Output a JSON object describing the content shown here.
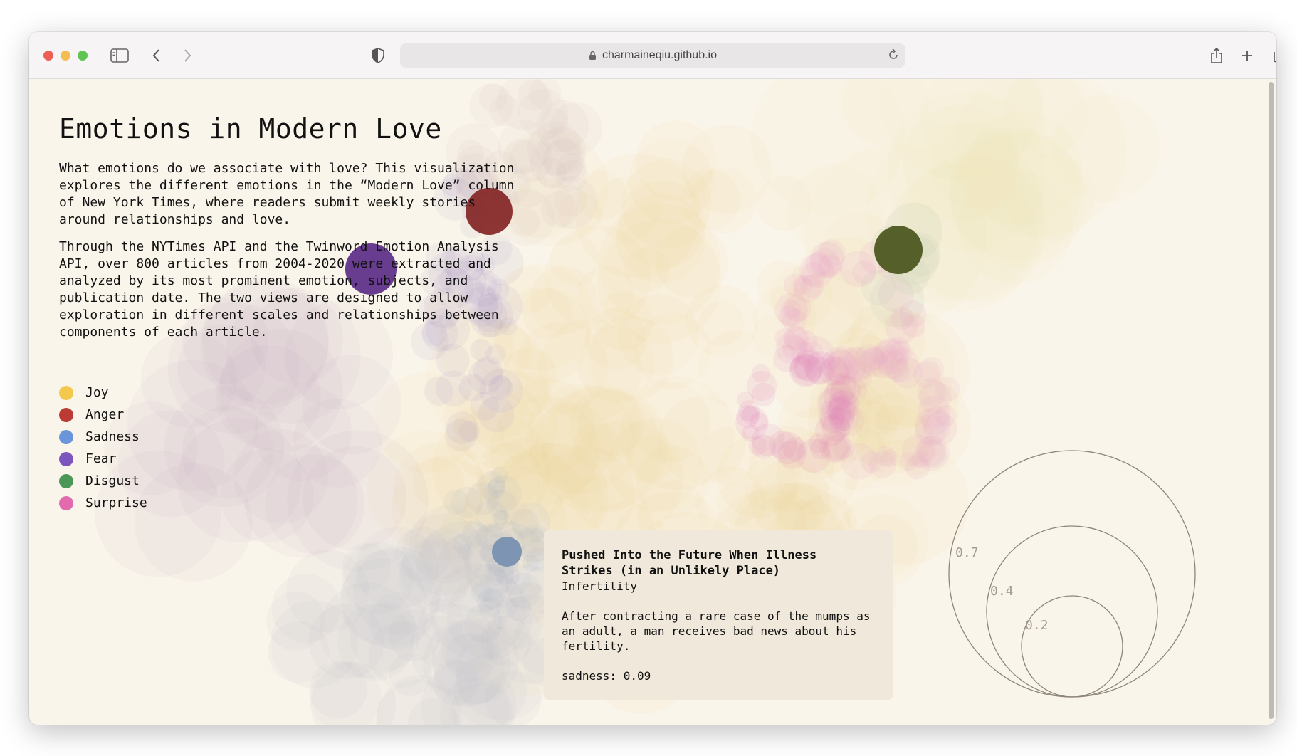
{
  "browser": {
    "url": "charmaineqiu.github.io",
    "traffic_colors": [
      "#ec5f57",
      "#f3bd4f",
      "#5fc453"
    ]
  },
  "page": {
    "title": "Emotions in Modern Love",
    "intro": "What emotions do we associate with love? This visualization explores the different emotions in the “Modern Love” column of New York Times, where readers submit weekly stories around relationships and love.",
    "method": "Through the NYTimes API and the Twinword Emotion Analysis API, over 800 articles from 2004-2020 were extracted and analyzed by its most prominent emotion, subjects, and publication date. The two views are designed to allow exploration in different scales and relationships between components of each article."
  },
  "legend": [
    {
      "label": "Joy",
      "color": "#f3c84e"
    },
    {
      "label": "Anger",
      "color": "#bb3a33"
    },
    {
      "label": "Sadness",
      "color": "#6b95db"
    },
    {
      "label": "Fear",
      "color": "#7d55bf"
    },
    {
      "label": "Disgust",
      "color": "#4a9758"
    },
    {
      "label": "Surprise",
      "color": "#e46aaf"
    }
  ],
  "tooltip": {
    "title": "Pushed Into the Future When Illness Strikes (in an Unlikely Place)",
    "subject": "Infertility",
    "summary": "After contracting a rare case of the mumps as an adult, a man receives bad news about his fertility.",
    "score": "sadness: 0.09"
  },
  "size_legend": {
    "labels": [
      "0.7",
      "0.4",
      "0.2"
    ]
  }
}
